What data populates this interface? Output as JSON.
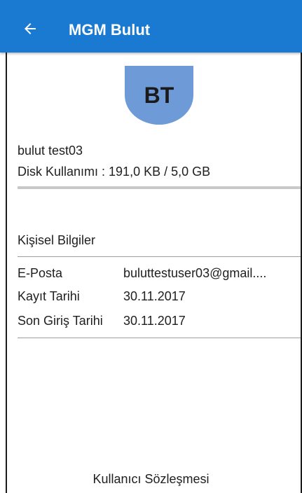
{
  "appbar": {
    "title": "MGM Bulut",
    "back_icon": "arrow-left-icon",
    "color": "#1a7ad1"
  },
  "profile": {
    "initials": "BT",
    "avatar_color": "#6e9ad8",
    "username": "bulut test03",
    "disk_usage_text": "Disk Kullanımı : 191,0 KB /  5,0 GB",
    "disk_usage_fraction": 0.0
  },
  "personal_info": {
    "section_title": "Kişisel Bilgiler",
    "rows": [
      {
        "label": "E-Posta",
        "value": "buluttestuser03@gmail...."
      },
      {
        "label": "Kayıt Tarihi",
        "value": "30.11.2017"
      },
      {
        "label": "Son Giriş Tarihi",
        "value": "30.11.2017"
      }
    ]
  },
  "footer": {
    "terms_link": "Kullanıcı Sözleşmesi"
  }
}
